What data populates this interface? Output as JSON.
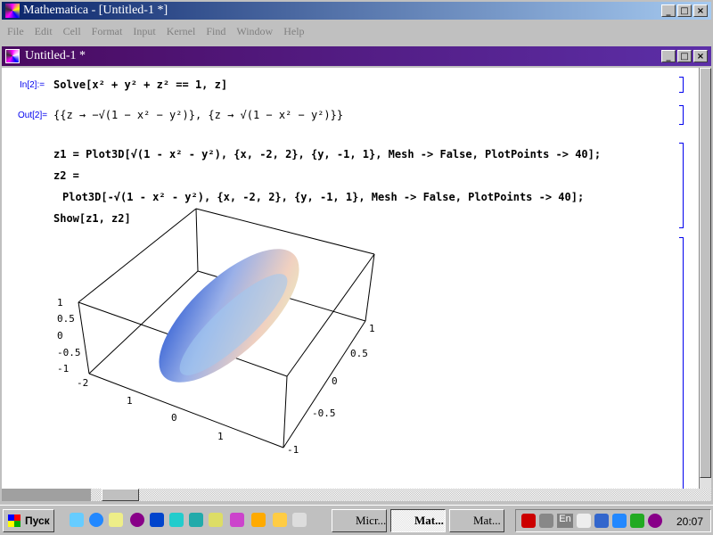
{
  "window": {
    "title": "Mathematica - [Untitled-1 *]"
  },
  "menu": [
    "File",
    "Edit",
    "Cell",
    "Format",
    "Input",
    "Kernel",
    "Find",
    "Window",
    "Help"
  ],
  "document": {
    "title": "Untitled-1 *"
  },
  "cells": {
    "in_label": "In[2]:=",
    "in_code": "Solve[x² + y² + z² == 1, z]",
    "out_label": "Out[2]=",
    "out_text": "{{z → −√(1 − x² − y²)}, {z → √(1 − x² − y²)}}",
    "line1": "z1 = Plot3D[√(1 - x² - y²), {x, -2, 2}, {y, -1, 1}, Mesh -> False, PlotPoints -> 40];",
    "line2": "z2 =",
    "line3": "Plot3D[-√(1 - x² - y²), {x, -2, 2}, {y, -1, 1}, Mesh -> False, PlotPoints -> 40];",
    "line4": "Show[z1, z2]"
  },
  "plot": {
    "z_ticks": [
      "1",
      "0.5",
      "0",
      "-0.5",
      "-1"
    ],
    "x_ticks": [
      "-2",
      "1",
      "0",
      "1"
    ],
    "y_ticks": [
      "1",
      "0.5",
      "0",
      "-0.5",
      "-1"
    ]
  },
  "taskbar": {
    "start": "Пуск",
    "tasks": [
      "Micr...",
      "Mat...",
      "Mat..."
    ],
    "lang": "En",
    "clock": "20:07"
  }
}
